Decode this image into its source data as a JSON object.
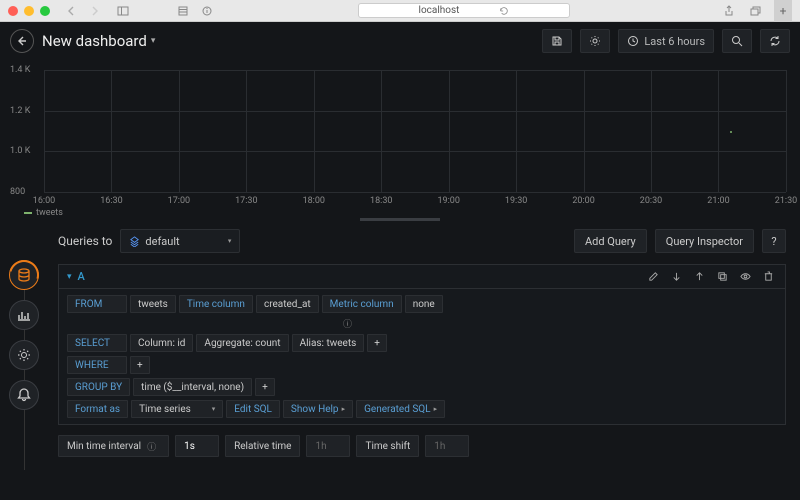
{
  "browser": {
    "url": "localhost",
    "share_title": "Share",
    "tabs_title": "Tabs"
  },
  "topbar": {
    "title": "New dashboard",
    "timerange": "Last 6 hours",
    "save_title": "Save",
    "settings_title": "Settings",
    "zoom_title": "Zoom",
    "refresh_title": "Refresh"
  },
  "chart_data": {
    "type": "line",
    "title": "",
    "xlabel": "",
    "ylabel": "",
    "ylim": [
      800,
      1400
    ],
    "yticks": [
      "800",
      "1.0 K",
      "1.2 K",
      "1.4 K"
    ],
    "xticks": [
      "16:00",
      "16:30",
      "17:00",
      "17:30",
      "18:00",
      "18:30",
      "19:00",
      "19:30",
      "20:00",
      "20:30",
      "21:00",
      "21:30"
    ],
    "series": [
      {
        "name": "tweets",
        "color": "#7eb26d",
        "points": [
          {
            "x": "21:05",
            "y": 1100
          }
        ]
      }
    ]
  },
  "queries": {
    "to_label": "Queries to",
    "datasource": "default",
    "add_query": "Add Query",
    "inspector": "Query Inspector",
    "help_label": "?"
  },
  "query": {
    "letter": "A",
    "from": {
      "kw": "FROM",
      "table": "tweets",
      "time_col_kw": "Time column",
      "time_col": "created_at",
      "metric_col_kw": "Metric column",
      "metric_col": "none"
    },
    "select": {
      "kw": "SELECT",
      "col": "Column: id",
      "agg": "Aggregate: count",
      "alias": "Alias: tweets"
    },
    "where": {
      "kw": "WHERE"
    },
    "groupby": {
      "kw": "GROUP BY",
      "expr": "time ($__interval, none)"
    },
    "format": {
      "kw": "Format as",
      "value": "Time series",
      "edit_sql": "Edit SQL",
      "show_help": "Show Help",
      "gen_sql": "Generated SQL"
    }
  },
  "footer": {
    "min_interval_label": "Min time interval",
    "min_interval_value": "1s",
    "relative_label": "Relative time",
    "relative_placeholder": "1h",
    "shift_label": "Time shift",
    "shift_placeholder": "1h"
  }
}
